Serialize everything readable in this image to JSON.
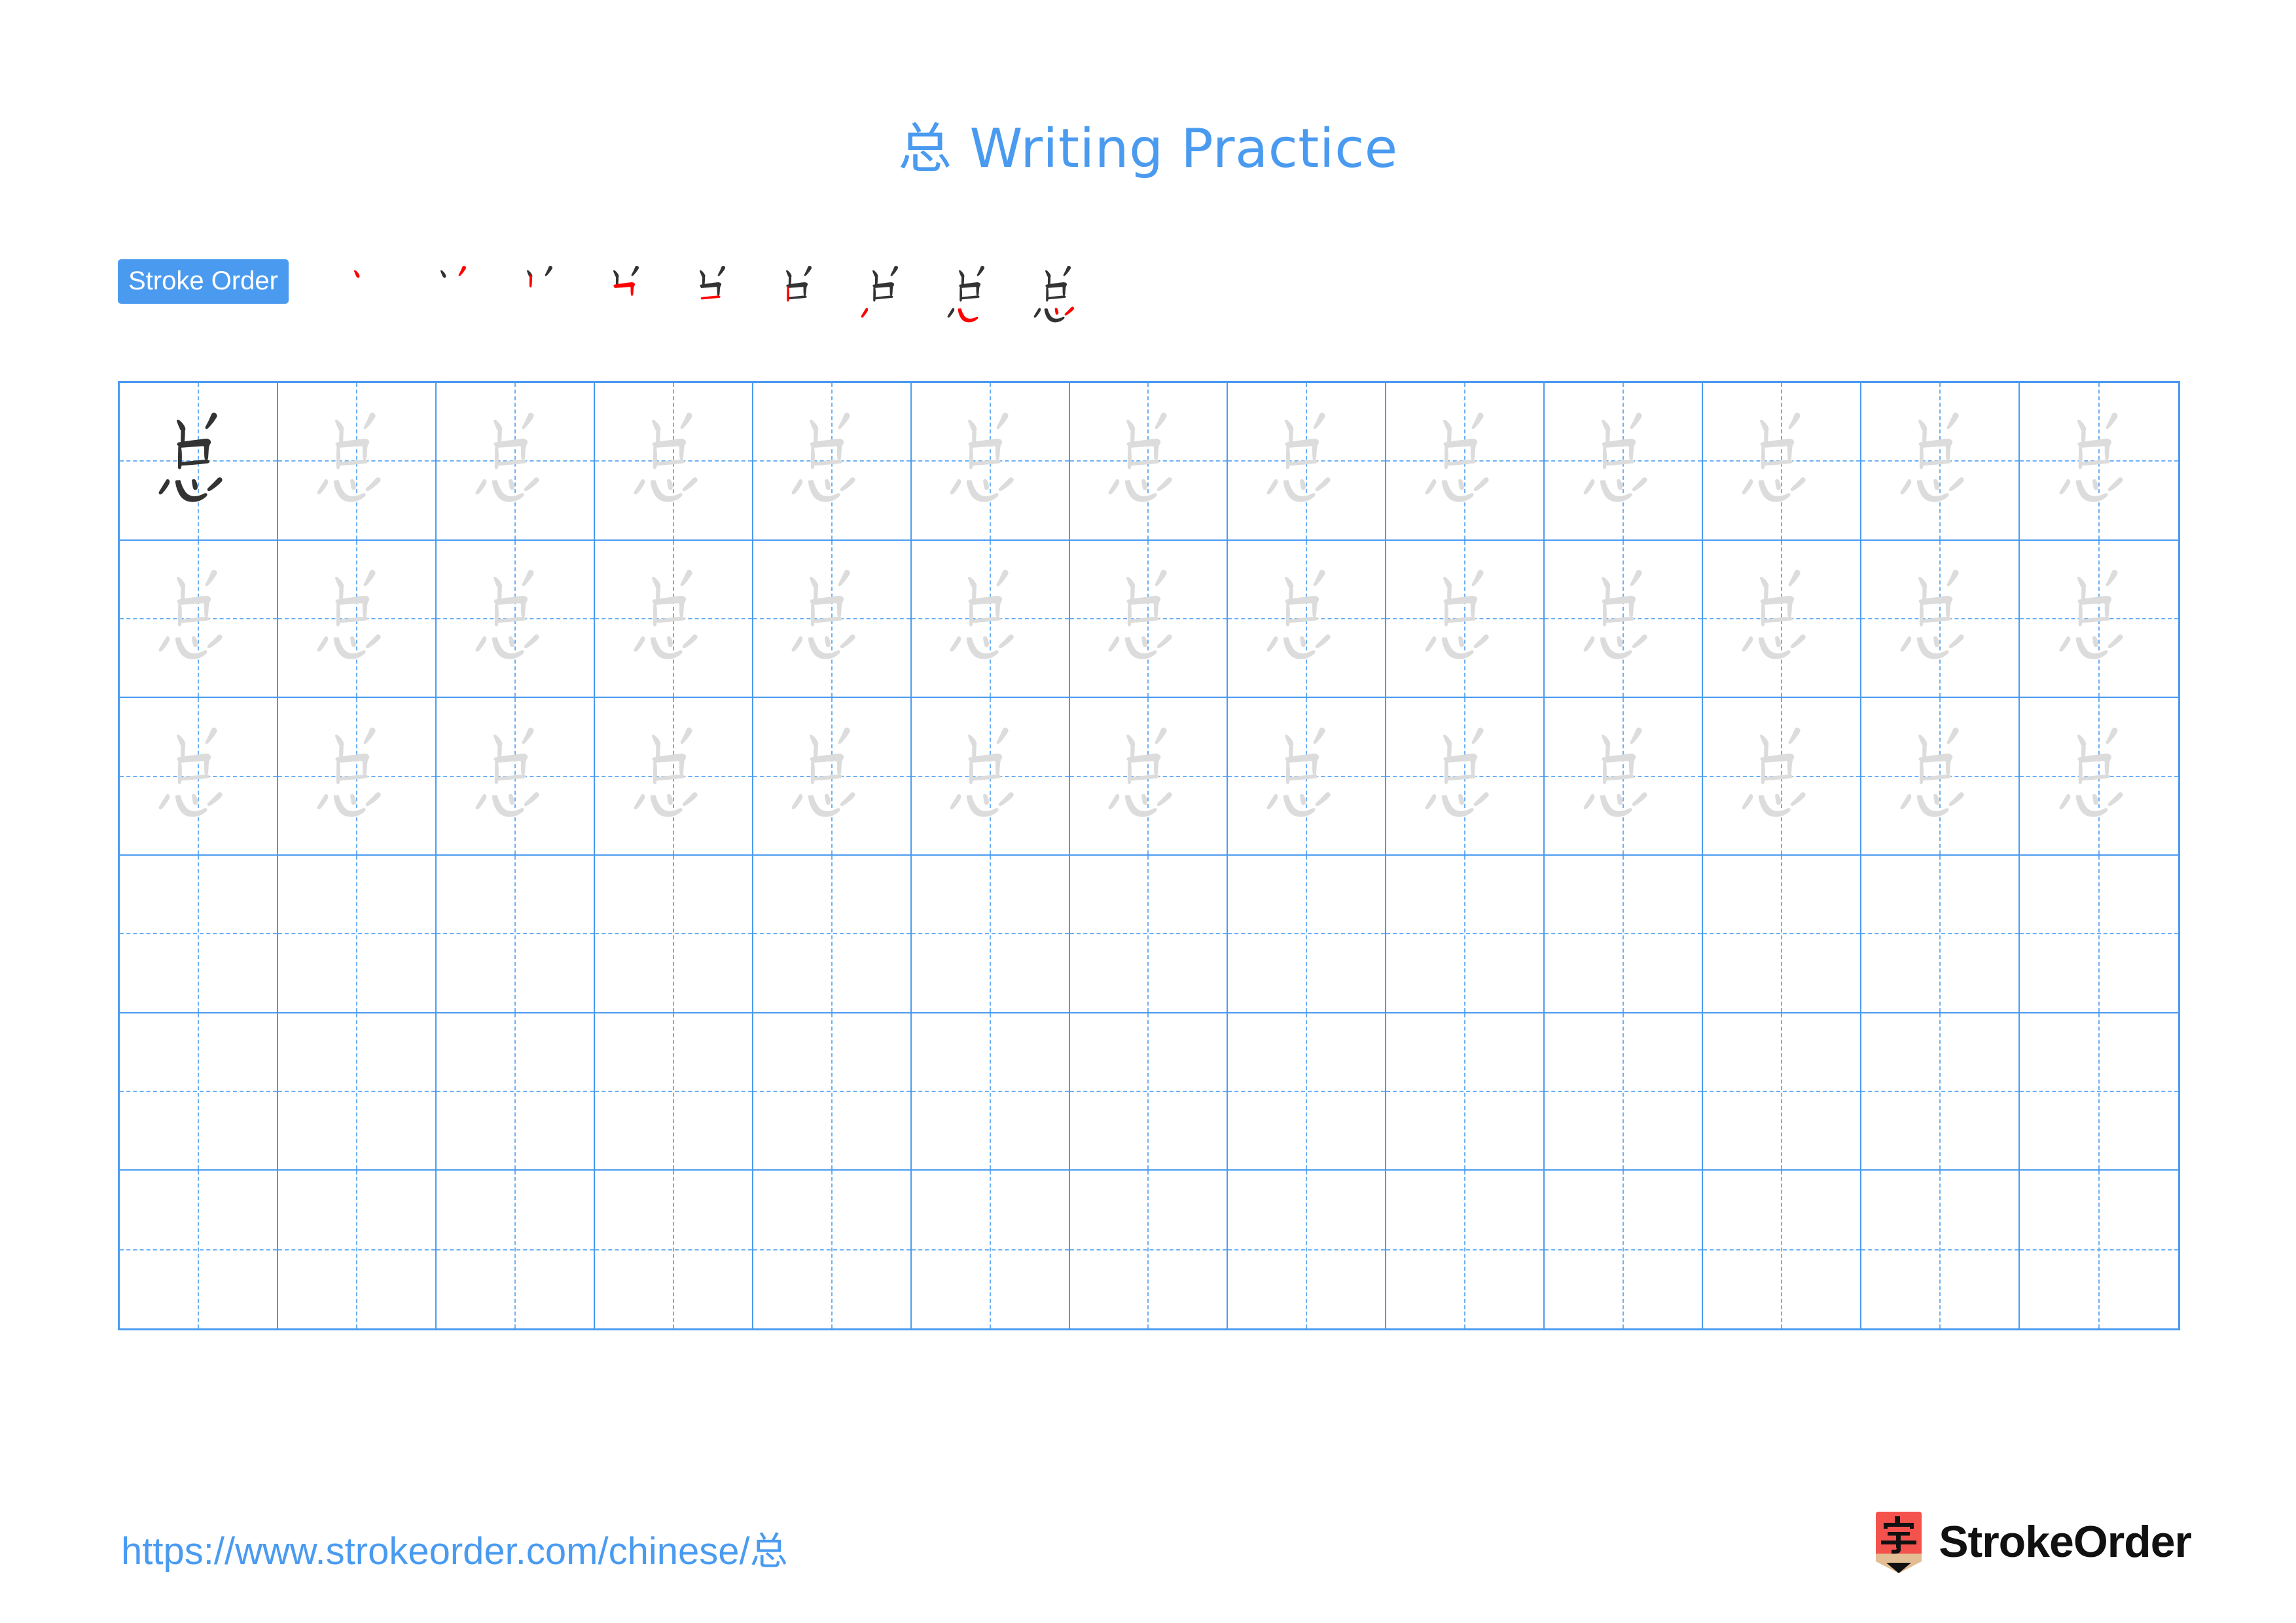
{
  "page": {
    "character": "总",
    "title_suffix": " Writing Practice",
    "title_full": "总 Writing Practice",
    "accent_color": "#4a9bf0",
    "grid_line_color": "#4a9bf0",
    "guide_line_color": "#6cb0f5",
    "trace_char_color": "#dcdcdc",
    "model_char_color": "#333333",
    "new_stroke_color": "#ff0000",
    "prev_stroke_color": "#333333"
  },
  "stroke_order": {
    "badge_label": "Stroke Order",
    "total_strokes": 9,
    "steps": [
      {
        "index": 1,
        "new_stroke": 1
      },
      {
        "index": 2,
        "new_stroke": 2
      },
      {
        "index": 3,
        "new_stroke": 3
      },
      {
        "index": 4,
        "new_stroke": 4
      },
      {
        "index": 5,
        "new_stroke": 5
      },
      {
        "index": 6,
        "new_stroke": 6
      },
      {
        "index": 7,
        "new_stroke": 7
      },
      {
        "index": 8,
        "new_stroke": 8
      },
      {
        "index": 9,
        "new_stroke": 9
      }
    ]
  },
  "practice_grid": {
    "columns": 13,
    "rows": 6,
    "cells": [
      [
        "model",
        "trace",
        "trace",
        "trace",
        "trace",
        "trace",
        "trace",
        "trace",
        "trace",
        "trace",
        "trace",
        "trace",
        "trace"
      ],
      [
        "trace",
        "trace",
        "trace",
        "trace",
        "trace",
        "trace",
        "trace",
        "trace",
        "trace",
        "trace",
        "trace",
        "trace",
        "trace"
      ],
      [
        "trace",
        "trace",
        "trace",
        "trace",
        "trace",
        "trace",
        "trace",
        "trace",
        "trace",
        "trace",
        "trace",
        "trace",
        "trace"
      ],
      [
        "empty",
        "empty",
        "empty",
        "empty",
        "empty",
        "empty",
        "empty",
        "empty",
        "empty",
        "empty",
        "empty",
        "empty",
        "empty"
      ],
      [
        "empty",
        "empty",
        "empty",
        "empty",
        "empty",
        "empty",
        "empty",
        "empty",
        "empty",
        "empty",
        "empty",
        "empty",
        "empty"
      ],
      [
        "empty",
        "empty",
        "empty",
        "empty",
        "empty",
        "empty",
        "empty",
        "empty",
        "empty",
        "empty",
        "empty",
        "empty",
        "empty"
      ]
    ]
  },
  "footer": {
    "url": "https://www.strokeorder.com/chinese/总",
    "brand_name": "StrokeOrder",
    "logo_char": "字",
    "logo_bg_color": "#f4524d",
    "logo_tip_color": "#e3bd94"
  }
}
